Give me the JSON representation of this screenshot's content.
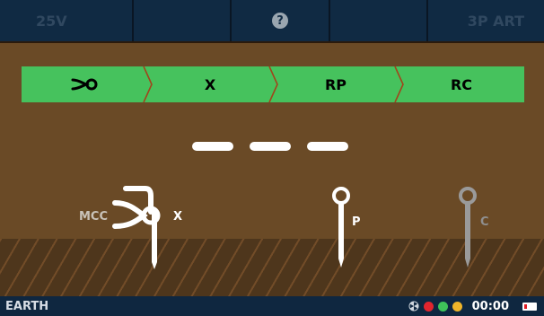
{
  "topbar": {
    "buttons": [
      {
        "label": "25V"
      },
      {
        "label": ""
      },
      {
        "icon": "help-icon",
        "label": "?"
      },
      {
        "label": ""
      },
      {
        "label": "3P ART"
      }
    ]
  },
  "steps": [
    {
      "icon": "clamp-cut-icon",
      "label": ""
    },
    {
      "label": "X"
    },
    {
      "label": "RP"
    },
    {
      "label": "RC"
    }
  ],
  "probes": {
    "mcc_label": "MCC",
    "x_label": "X",
    "p_label": "P",
    "c_label": "C"
  },
  "status": {
    "title": "EARTH",
    "time": "00:00",
    "indicator_colors": [
      "#e2252e",
      "#3fc35a",
      "#f0b52a"
    ],
    "battery_level_percent": 15
  },
  "colors": {
    "accent_green": "#46c25d",
    "background_brown": "#6a4a26",
    "bar_blue": "#102a43"
  }
}
